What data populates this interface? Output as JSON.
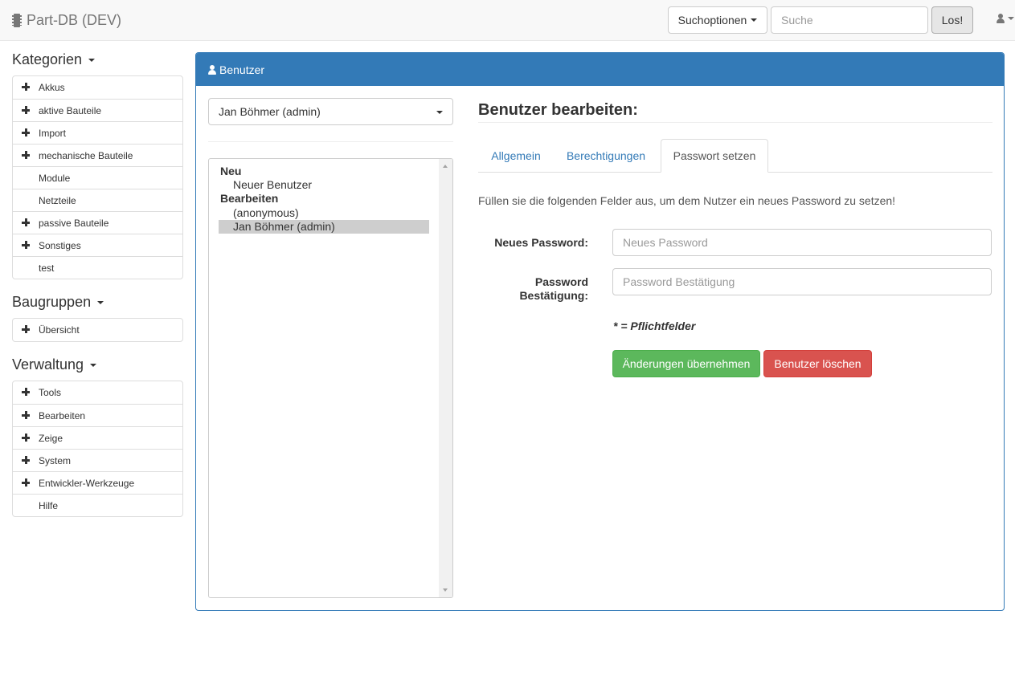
{
  "navbar": {
    "brand": "Part-DB (DEV)",
    "search_options_label": "Suchoptionen",
    "search_placeholder": "Suche",
    "search_value": "",
    "go_label": "Los!"
  },
  "sidebar": {
    "kategorien": {
      "title": "Kategorien",
      "items": [
        {
          "label": "Akkus",
          "expandable": true
        },
        {
          "label": "aktive Bauteile",
          "expandable": true
        },
        {
          "label": "Import",
          "expandable": true
        },
        {
          "label": "mechanische Bauteile",
          "expandable": true
        },
        {
          "label": "Module",
          "expandable": false
        },
        {
          "label": "Netzteile",
          "expandable": false
        },
        {
          "label": "passive Bauteile",
          "expandable": true
        },
        {
          "label": "Sonstiges",
          "expandable": true
        },
        {
          "label": "test",
          "expandable": false
        }
      ]
    },
    "baugruppen": {
      "title": "Baugruppen",
      "items": [
        {
          "label": "Übersicht",
          "expandable": true
        }
      ]
    },
    "verwaltung": {
      "title": "Verwaltung",
      "items": [
        {
          "label": "Tools",
          "expandable": true
        },
        {
          "label": "Bearbeiten",
          "expandable": true
        },
        {
          "label": "Zeige",
          "expandable": true
        },
        {
          "label": "System",
          "expandable": true
        },
        {
          "label": "Entwickler-Werkzeuge",
          "expandable": true
        },
        {
          "label": "Hilfe",
          "expandable": false
        }
      ]
    }
  },
  "panel": {
    "heading": "Benutzer",
    "user_select_value": "Jan Böhmer (admin)",
    "list": {
      "group_new": "Neu",
      "new_user": "Neuer Benutzer",
      "group_edit": "Bearbeiten",
      "users": [
        "(anonymous)",
        "Jan Böhmer (admin)"
      ],
      "selected": "Jan Böhmer (admin)"
    },
    "form_title": "Benutzer bearbeiten:",
    "tabs": [
      {
        "label": "Allgemein",
        "active": false
      },
      {
        "label": "Berechtigungen",
        "active": false
      },
      {
        "label": "Passwort setzen",
        "active": true
      }
    ],
    "instructions": "Füllen sie die folgenden Felder aus, um dem Nutzer ein neues Password zu setzen!",
    "fields": {
      "new_password_label": "Neues Password:",
      "new_password_placeholder": "Neues Password",
      "confirm_label_line1": "Password",
      "confirm_label_line2": "Bestätigung:",
      "confirm_placeholder": "Password Bestätigung"
    },
    "required_note": "* = Pflichtfelder",
    "apply_label": "Änderungen übernehmen",
    "delete_label": "Benutzer löschen"
  },
  "colors": {
    "primary": "#337ab7",
    "success": "#5cb85c",
    "danger": "#d9534f"
  }
}
